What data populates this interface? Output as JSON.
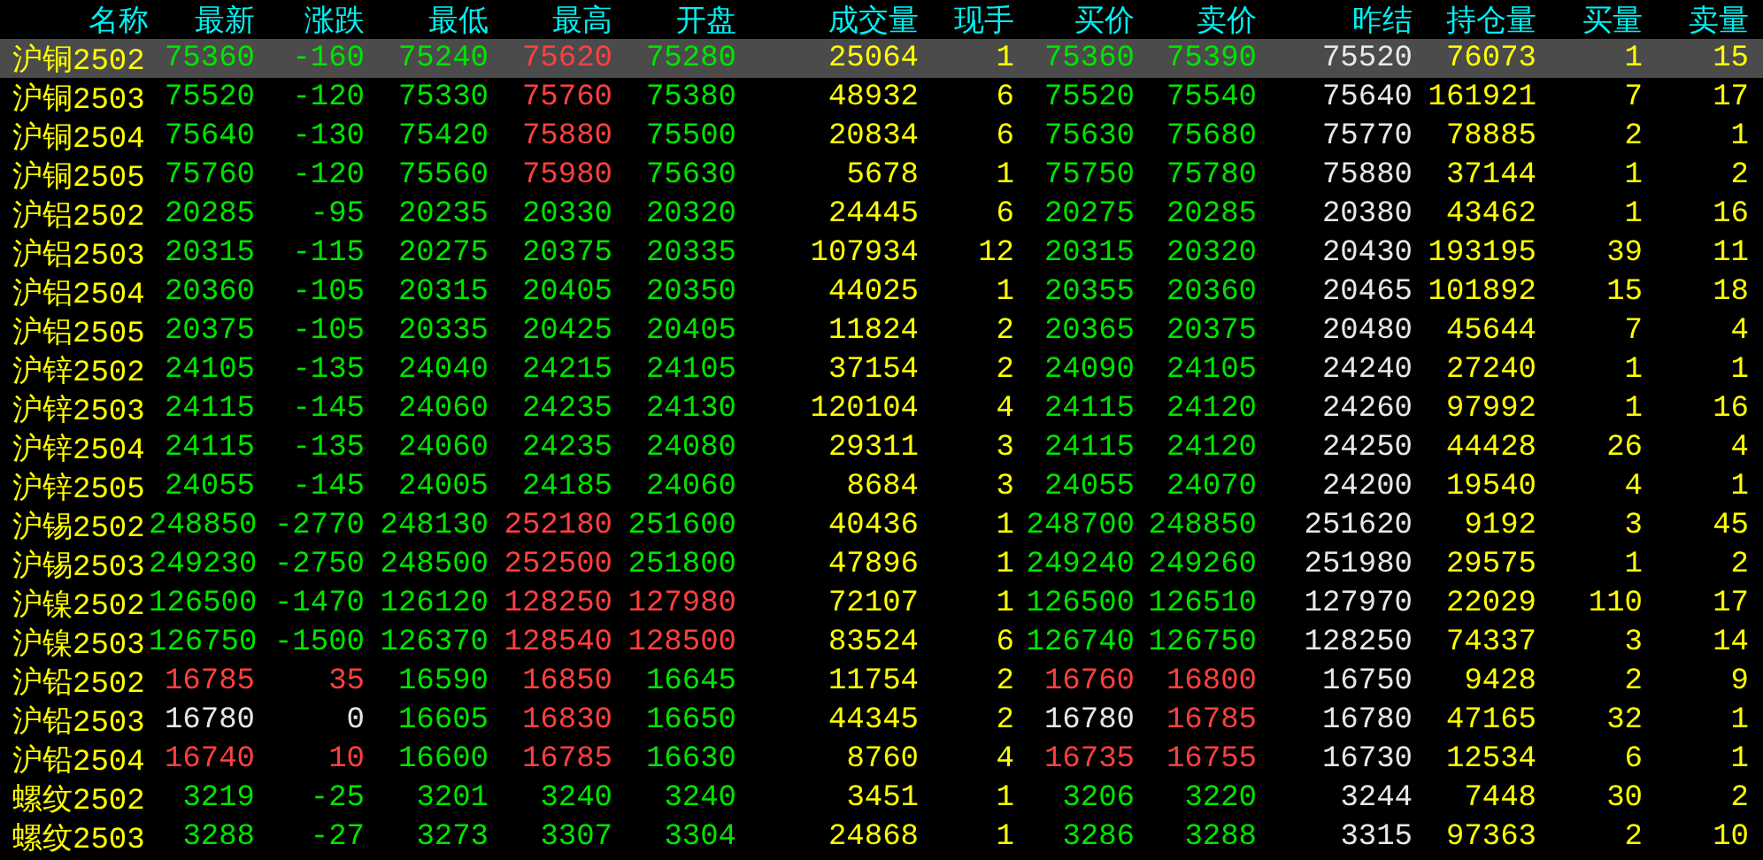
{
  "table": {
    "columns": [
      {
        "label": "名称",
        "kind": "name"
      },
      {
        "label": "最新",
        "kind": "price"
      },
      {
        "label": "涨跌",
        "kind": "change"
      },
      {
        "label": "最低",
        "kind": "price"
      },
      {
        "label": "最高",
        "kind": "price"
      },
      {
        "label": "开盘",
        "kind": "price"
      },
      {
        "label": "成交量",
        "kind": "volume"
      },
      {
        "label": "现手",
        "kind": "volume"
      },
      {
        "label": "买价",
        "kind": "price"
      },
      {
        "label": "卖价",
        "kind": "price"
      },
      {
        "label": "昨结",
        "kind": "reference"
      },
      {
        "label": "持仓量",
        "kind": "volume"
      },
      {
        "label": "买量",
        "kind": "volume"
      },
      {
        "label": "卖量",
        "kind": "volume"
      }
    ],
    "rows": [
      {
        "selected": true,
        "cells": [
          "沪铜2502",
          "75360",
          "-160",
          "75240",
          "75620",
          "75280",
          "25064",
          "1",
          "75360",
          "75390",
          "75520",
          "76073",
          "1",
          "15"
        ]
      },
      {
        "selected": false,
        "cells": [
          "沪铜2503",
          "75520",
          "-120",
          "75330",
          "75760",
          "75380",
          "48932",
          "6",
          "75520",
          "75540",
          "75640",
          "161921",
          "7",
          "17"
        ]
      },
      {
        "selected": false,
        "cells": [
          "沪铜2504",
          "75640",
          "-130",
          "75420",
          "75880",
          "75500",
          "20834",
          "6",
          "75630",
          "75680",
          "75770",
          "78885",
          "2",
          "1"
        ]
      },
      {
        "selected": false,
        "cells": [
          "沪铜2505",
          "75760",
          "-120",
          "75560",
          "75980",
          "75630",
          "5678",
          "1",
          "75750",
          "75780",
          "75880",
          "37144",
          "1",
          "2"
        ]
      },
      {
        "selected": false,
        "cells": [
          "沪铝2502",
          "20285",
          "-95",
          "20235",
          "20330",
          "20320",
          "24445",
          "6",
          "20275",
          "20285",
          "20380",
          "43462",
          "1",
          "16"
        ]
      },
      {
        "selected": false,
        "cells": [
          "沪铝2503",
          "20315",
          "-115",
          "20275",
          "20375",
          "20335",
          "107934",
          "12",
          "20315",
          "20320",
          "20430",
          "193195",
          "39",
          "11"
        ]
      },
      {
        "selected": false,
        "cells": [
          "沪铝2504",
          "20360",
          "-105",
          "20315",
          "20405",
          "20350",
          "44025",
          "1",
          "20355",
          "20360",
          "20465",
          "101892",
          "15",
          "18"
        ]
      },
      {
        "selected": false,
        "cells": [
          "沪铝2505",
          "20375",
          "-105",
          "20335",
          "20425",
          "20405",
          "11824",
          "2",
          "20365",
          "20375",
          "20480",
          "45644",
          "7",
          "4"
        ]
      },
      {
        "selected": false,
        "cells": [
          "沪锌2502",
          "24105",
          "-135",
          "24040",
          "24215",
          "24105",
          "37154",
          "2",
          "24090",
          "24105",
          "24240",
          "27240",
          "1",
          "1"
        ]
      },
      {
        "selected": false,
        "cells": [
          "沪锌2503",
          "24115",
          "-145",
          "24060",
          "24235",
          "24130",
          "120104",
          "4",
          "24115",
          "24120",
          "24260",
          "97992",
          "1",
          "16"
        ]
      },
      {
        "selected": false,
        "cells": [
          "沪锌2504",
          "24115",
          "-135",
          "24060",
          "24235",
          "24080",
          "29311",
          "3",
          "24115",
          "24120",
          "24250",
          "44428",
          "26",
          "4"
        ]
      },
      {
        "selected": false,
        "cells": [
          "沪锌2505",
          "24055",
          "-145",
          "24005",
          "24185",
          "24060",
          "8684",
          "3",
          "24055",
          "24070",
          "24200",
          "19540",
          "4",
          "1"
        ]
      },
      {
        "selected": false,
        "cells": [
          "沪锡2502",
          "248850",
          "-2770",
          "248130",
          "252180",
          "251600",
          "40436",
          "1",
          "248700",
          "248850",
          "251620",
          "9192",
          "3",
          "45"
        ]
      },
      {
        "selected": false,
        "cells": [
          "沪锡2503",
          "249230",
          "-2750",
          "248500",
          "252500",
          "251800",
          "47896",
          "1",
          "249240",
          "249260",
          "251980",
          "29575",
          "1",
          "2"
        ]
      },
      {
        "selected": false,
        "cells": [
          "沪镍2502",
          "126500",
          "-1470",
          "126120",
          "128250",
          "127980",
          "72107",
          "1",
          "126500",
          "126510",
          "127970",
          "22029",
          "110",
          "17"
        ]
      },
      {
        "selected": false,
        "cells": [
          "沪镍2503",
          "126750",
          "-1500",
          "126370",
          "128540",
          "128500",
          "83524",
          "6",
          "126740",
          "126750",
          "128250",
          "74337",
          "3",
          "14"
        ]
      },
      {
        "selected": false,
        "cells": [
          "沪铅2502",
          "16785",
          "35",
          "16590",
          "16850",
          "16645",
          "11754",
          "2",
          "16760",
          "16800",
          "16750",
          "9428",
          "2",
          "9"
        ]
      },
      {
        "selected": false,
        "cells": [
          "沪铅2503",
          "16780",
          "0",
          "16605",
          "16830",
          "16650",
          "44345",
          "2",
          "16780",
          "16785",
          "16780",
          "47165",
          "32",
          "1"
        ]
      },
      {
        "selected": false,
        "cells": [
          "沪铅2504",
          "16740",
          "10",
          "16600",
          "16785",
          "16630",
          "8760",
          "4",
          "16735",
          "16755",
          "16730",
          "12534",
          "6",
          "1"
        ]
      },
      {
        "selected": false,
        "cells": [
          "螺纹2502",
          "3219",
          "-25",
          "3201",
          "3240",
          "3240",
          "3451",
          "1",
          "3206",
          "3220",
          "3244",
          "7448",
          "30",
          "2"
        ]
      },
      {
        "selected": false,
        "cells": [
          "螺纹2503",
          "3288",
          "-27",
          "3273",
          "3307",
          "3304",
          "24868",
          "1",
          "3286",
          "3288",
          "3315",
          "97363",
          "2",
          "10"
        ]
      }
    ]
  }
}
